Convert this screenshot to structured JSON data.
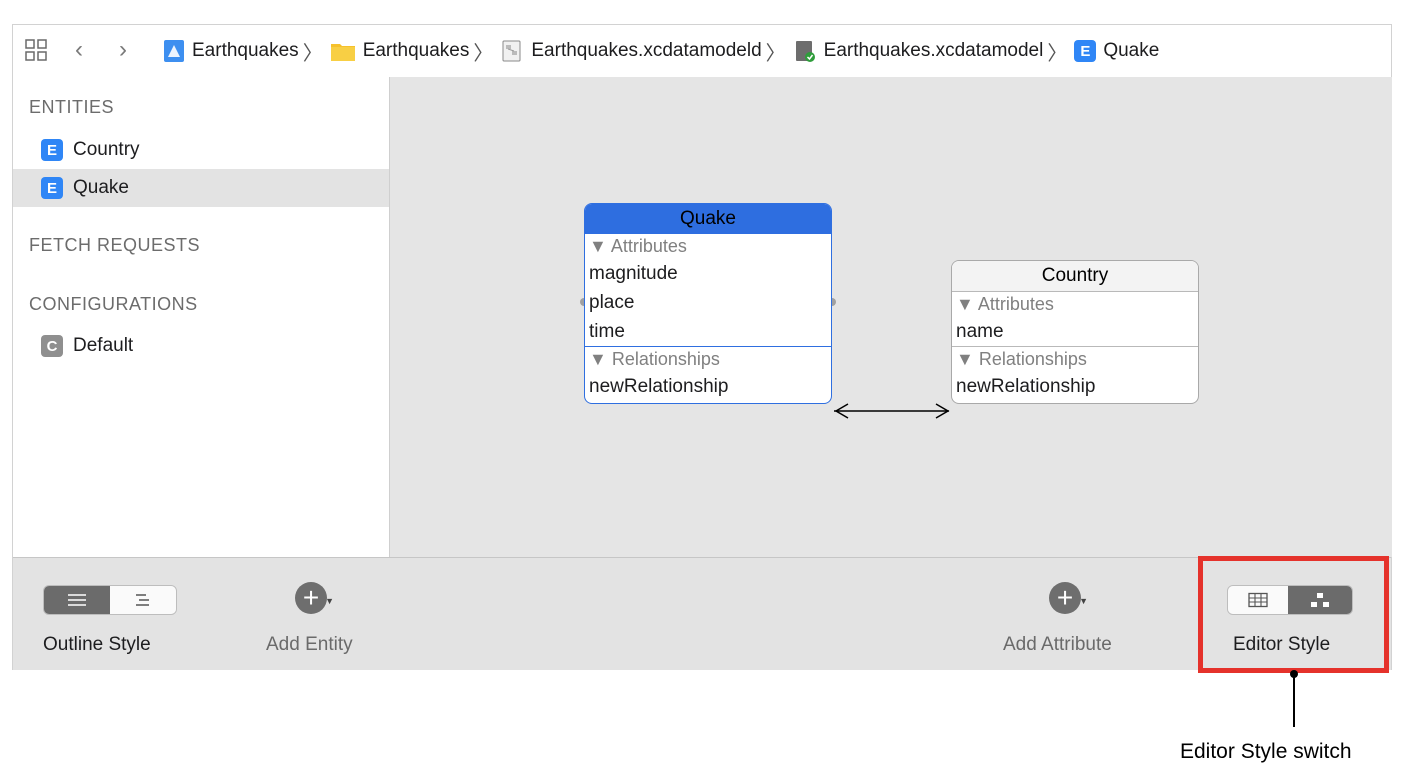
{
  "jumpbar": {
    "crumbs": [
      {
        "label": "Earthquakes",
        "icon": "project-icon"
      },
      {
        "label": "Earthquakes",
        "icon": "folder-icon"
      },
      {
        "label": "Earthquakes.xcdatamodeld",
        "icon": "model-bundle-icon"
      },
      {
        "label": "Earthquakes.xcdatamodel",
        "icon": "model-file-icon"
      },
      {
        "label": "Quake",
        "icon": "entity-icon",
        "badge": "E"
      }
    ]
  },
  "sidebar": {
    "entities_header": "ENTITIES",
    "entities": [
      {
        "badge": "E",
        "label": "Country"
      },
      {
        "badge": "E",
        "label": "Quake"
      }
    ],
    "fetch_header": "FETCH REQUESTS",
    "config_header": "CONFIGURATIONS",
    "configurations": [
      {
        "badge": "C",
        "label": "Default"
      }
    ]
  },
  "diagram": {
    "quake": {
      "title": "Quake",
      "attributes_header": "▼ Attributes",
      "attributes": [
        "magnitude",
        "place",
        "time"
      ],
      "relationships_header": "▼ Relationships",
      "relationships": [
        "newRelationship"
      ]
    },
    "country": {
      "title": "Country",
      "attributes_header": "▼ Attributes",
      "attributes": [
        "name"
      ],
      "relationships_header": "▼ Relationships",
      "relationships": [
        "newRelationship"
      ]
    }
  },
  "toolbar": {
    "outline_style_label": "Outline Style",
    "add_entity_label": "Add Entity",
    "add_attribute_label": "Add Attribute",
    "editor_style_label": "Editor Style"
  },
  "callout": {
    "text": "Editor Style switch",
    "color": "#e5322b"
  },
  "colors": {
    "accent": "#2e6ee0",
    "badge_entity": "#2f86f6",
    "badge_config": "#8f8f8f"
  }
}
